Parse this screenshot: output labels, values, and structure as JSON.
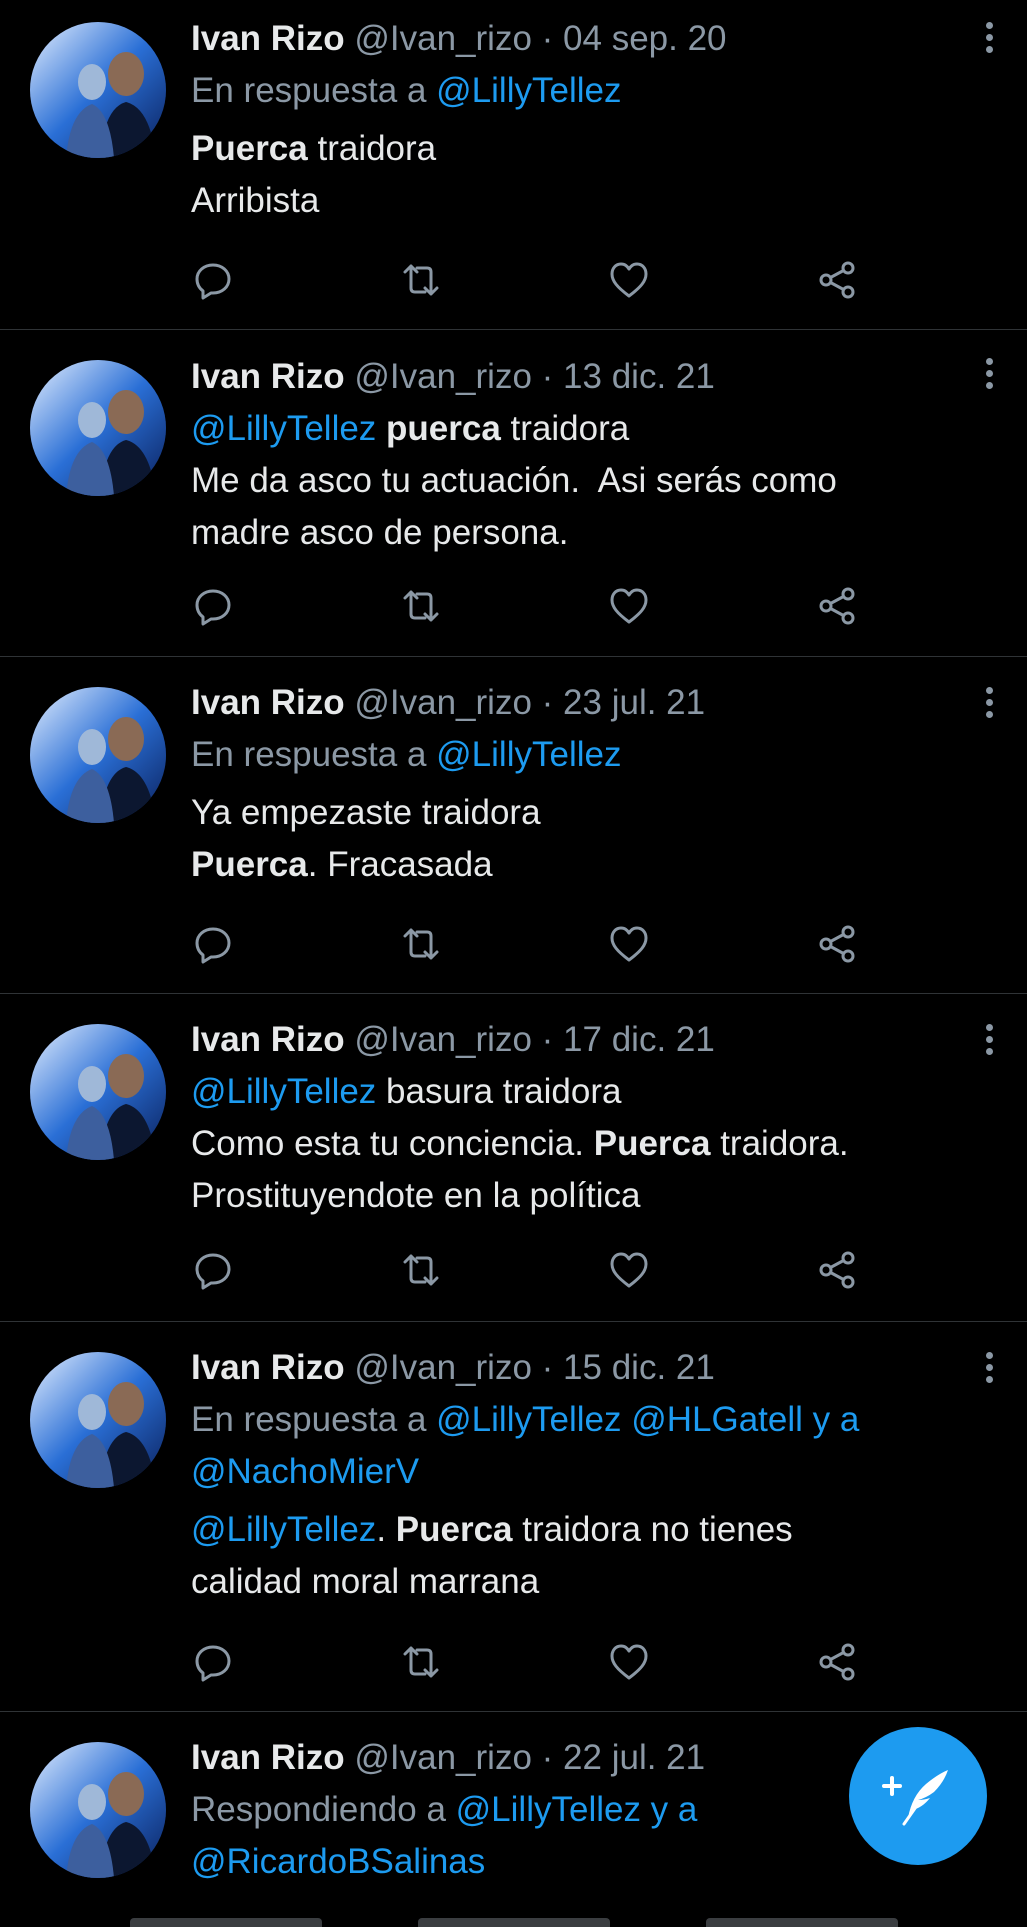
{
  "colors": {
    "background": "#000000",
    "text": "#e7e9ea",
    "muted": "#8b98a5",
    "accent": "#1d9bf0",
    "divider": "#2f3336"
  },
  "icons": {
    "reply": "reply-icon",
    "retweet": "retweet-icon",
    "like": "like-icon",
    "share": "share-icon",
    "more": "more-icon",
    "compose": "compose-tweet-icon"
  },
  "tweets": [
    {
      "name": "Ivan Rizo",
      "handle": "@Ivan_rizo",
      "date": "04 sep. 20",
      "reply_to": {
        "prefix": "En respuesta a ",
        "m1": "@LillyTellez"
      },
      "l1": {
        "b": "Puerca",
        "t": " traidora"
      },
      "l2": {
        "t": "Arribista"
      }
    },
    {
      "name": "Ivan Rizo",
      "handle": "@Ivan_rizo",
      "date": "13 dic. 21",
      "l1": {
        "m": "@LillyTellez",
        "b": " puerca",
        "t": " traidora"
      },
      "l2": {
        "t": "Me da asco tu actuación.  Asi serás como"
      },
      "l3": {
        "t": "madre asco de persona."
      }
    },
    {
      "name": "Ivan Rizo",
      "handle": "@Ivan_rizo",
      "date": "23 jul. 21",
      "reply_to": {
        "prefix": "En respuesta a ",
        "m1": "@LillyTellez"
      },
      "l1": {
        "t": "Ya empezaste traidora"
      },
      "l2": {
        "b": "Puerca",
        "t": ". Fracasada"
      }
    },
    {
      "name": "Ivan Rizo",
      "handle": "@Ivan_rizo",
      "date": "17 dic. 21",
      "l1": {
        "m": "@LillyTellez",
        "t": " basura traidora"
      },
      "l2": {
        "t": "Como esta tu conciencia. ",
        "b": "Puerca",
        "t2": " traidora."
      },
      "l3": {
        "t": "Prostituyendote en la política"
      }
    },
    {
      "name": "Ivan Rizo",
      "handle": "@Ivan_rizo",
      "date": "15 dic. 21",
      "reply_to": {
        "prefix": "En respuesta a ",
        "m1": "@LillyTellez",
        "m2": " @HLGatell",
        "m3": " y a",
        "m4": "@NachoMierV"
      },
      "l1": {
        "m": "@LillyTellez",
        "t": ". ",
        "b": "Puerca",
        "t2": " traidora no tienes"
      },
      "l2": {
        "t": "calidad moral marrana"
      }
    },
    {
      "name": "Ivan Rizo",
      "handle": "@Ivan_rizo",
      "date": "22 jul. 21",
      "reply_to": {
        "prefix": "Respondiendo a ",
        "m1": "@LillyTellez y a",
        "m4": "@RicardoBSalinas"
      }
    }
  ]
}
